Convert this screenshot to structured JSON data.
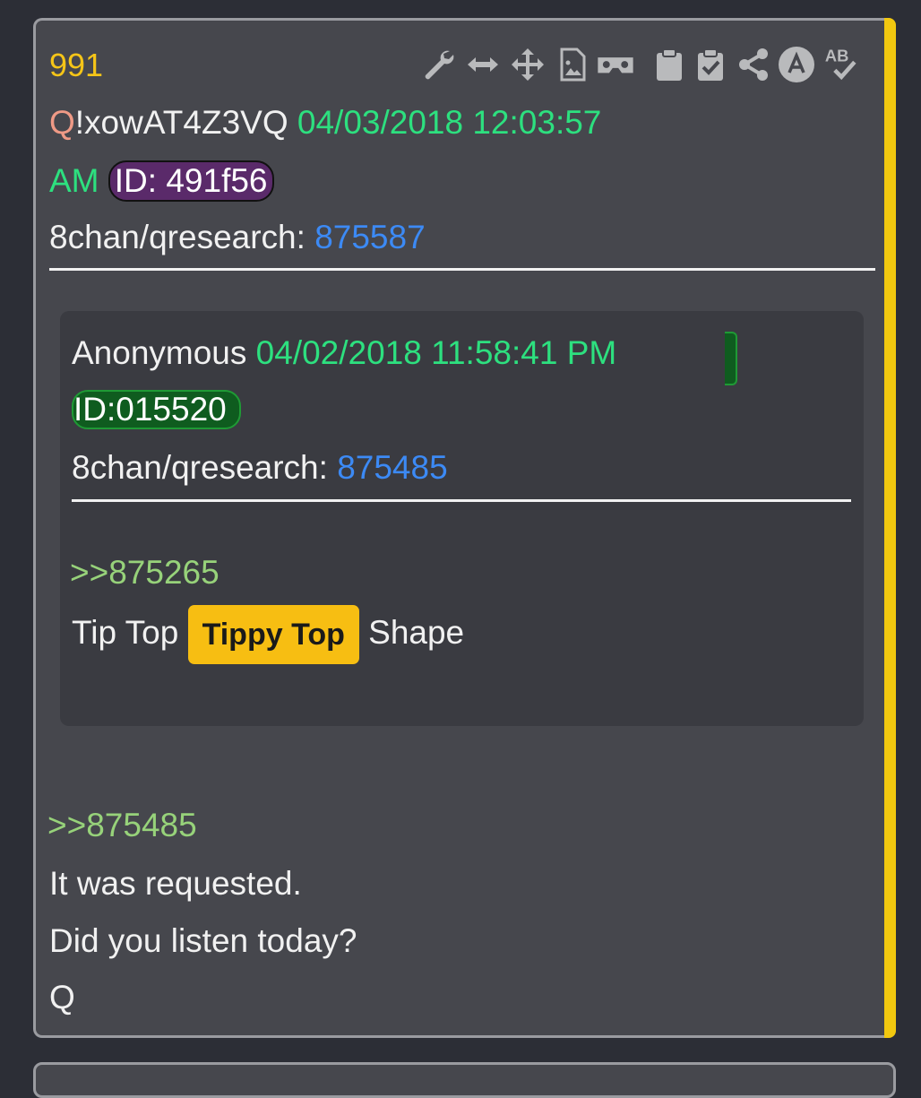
{
  "post": {
    "number": "991",
    "name": "Q",
    "tripcode": "!xowAT4Z3VQ",
    "date": "04/03/2018 12:03:57",
    "date_ampm": "AM",
    "id": "ID: 491f56",
    "board_label": "8chan/qresearch:",
    "post_ref": "875587",
    "toolbar": {
      "icons": [
        "wrench-icon",
        "arrows-horizontal-icon",
        "move-icon",
        "image-file-icon",
        "vr-headset-icon",
        "clipboard-icon",
        "clipboard-check-icon",
        "share-icon",
        "a-circle-icon",
        "spellcheck-icon"
      ],
      "spellcheck_text": "AB"
    },
    "quoted_post": {
      "name": "Anonymous",
      "date": "04/02/2018 11:58:41 PM",
      "id": "ID:015520",
      "board_label": "8chan/qresearch:",
      "post_ref": "875485",
      "reply_link": ">>875265",
      "text_before": "Tip Top",
      "highlight": "Tippy Top",
      "text_after": "Shape"
    },
    "reply_link": ">>875485",
    "body_lines": [
      "It was requested.",
      "Did you listen today?",
      "Q"
    ]
  },
  "colors": {
    "background": "#2c2e36",
    "card": "#46474d",
    "quoted_card": "#3a3b41",
    "accent_yellow": "#f2c80f",
    "date_green": "#2de07f",
    "link_blue": "#3c8af5",
    "quote_green": "#97d27a",
    "name_salmon": "#ef9a86",
    "id_purple": "#5a2a6a",
    "id_green": "#0f5c1f",
    "highlight": "#f7be12"
  }
}
